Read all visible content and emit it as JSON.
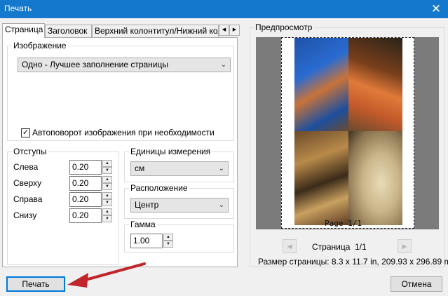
{
  "window": {
    "title": "Печать",
    "close_glyph": "✕"
  },
  "tabs": {
    "items": [
      {
        "label": "Страница"
      },
      {
        "label": "Заголовок"
      },
      {
        "label": "Верхний колонтитул/Нижний коло"
      }
    ],
    "scroll_left": "◀",
    "scroll_right": "▶"
  },
  "image_section": {
    "title": "Изображение",
    "fit_select": "Одно - Лучшее заполнение страницы",
    "autorotate_checked": true,
    "check_glyph": "✓",
    "autorotate_label": "Автоповорот изображения при необходимости"
  },
  "margins": {
    "title": "Отступы",
    "left_label": "Слева",
    "left_value": "0.20",
    "top_label": "Сверху",
    "top_value": "0.20",
    "right_label": "Справа",
    "right_value": "0.20",
    "bottom_label": "Снизу",
    "bottom_value": "0.20"
  },
  "units": {
    "title": "Единицы измерения",
    "value": "см"
  },
  "placement": {
    "title": "Расположение",
    "value": "Центр"
  },
  "gamma": {
    "title": "Гамма",
    "value": "1.00"
  },
  "spinner": {
    "up": "▲",
    "down": "▼"
  },
  "dropdown_icon": "⌄",
  "preview": {
    "title": "Предпросмотр",
    "page_marker": "Page 1/1",
    "page_label": "Страница",
    "page_counter": "1/1",
    "prev": "◀",
    "next": "▶",
    "page_size": "Размер страницы: 8.3 x 11.7 in, 209.93 x 296.89 mm"
  },
  "buttons": {
    "print": "Печать",
    "cancel": "Отмена"
  },
  "colors": {
    "titlebar": "#1478cc",
    "accent": "#0078d7",
    "arrow": "#c0262b"
  }
}
